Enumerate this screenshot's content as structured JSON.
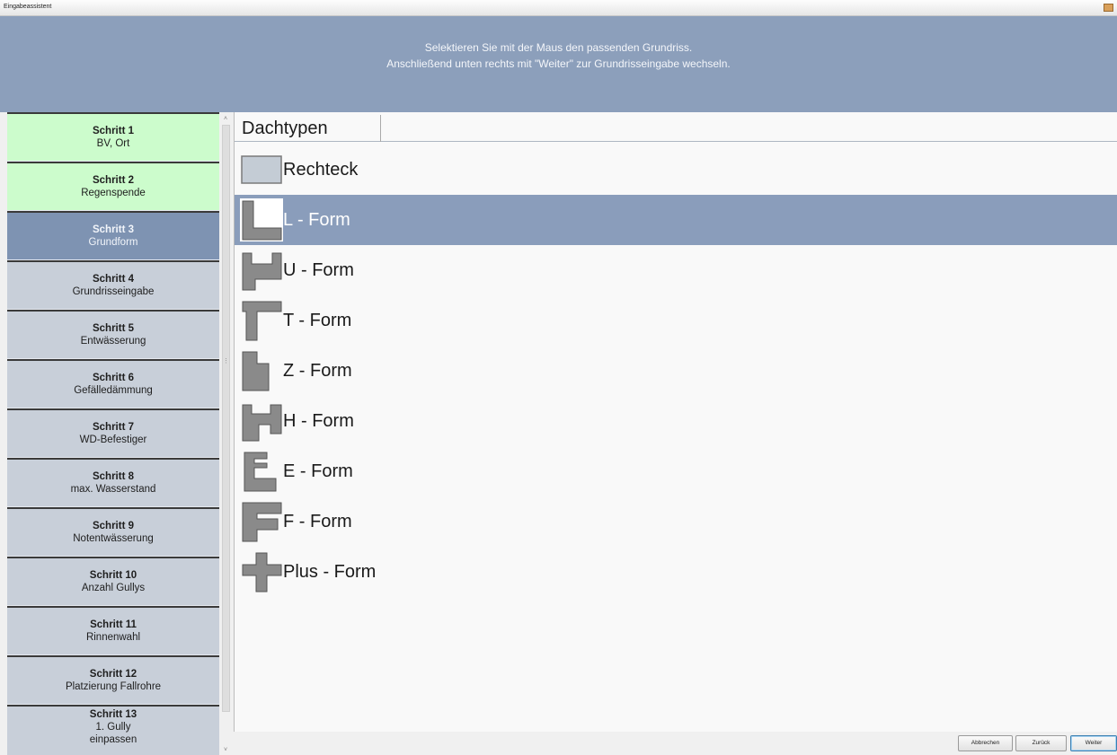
{
  "window": {
    "title": "Eingabeassistent"
  },
  "header": {
    "line1": "Selektieren Sie mit der Maus den passenden Grundriss.",
    "line2": "Anschließend unten rechts mit \"Weiter\" zur Grundrisseingabe wechseln."
  },
  "steps": [
    {
      "num": "Schritt 1",
      "name": "BV, Ort",
      "state": "done"
    },
    {
      "num": "Schritt 2",
      "name": "Regenspende",
      "state": "done"
    },
    {
      "num": "Schritt 3",
      "name": "Grundform",
      "state": "active"
    },
    {
      "num": "Schritt 4",
      "name": "Grundrisseingabe",
      "state": "pending"
    },
    {
      "num": "Schritt 5",
      "name": "Entwässerung",
      "state": "pending"
    },
    {
      "num": "Schritt 6",
      "name": "Gefälledämmung",
      "state": "pending"
    },
    {
      "num": "Schritt 7",
      "name": "WD-Befestiger",
      "state": "pending"
    },
    {
      "num": "Schritt 8",
      "name": "max. Wasserstand",
      "state": "pending"
    },
    {
      "num": "Schritt 9",
      "name": "Notentwässerung",
      "state": "pending"
    },
    {
      "num": "Schritt 10",
      "name": "Anzahl Gullys",
      "state": "pending"
    },
    {
      "num": "Schritt 11",
      "name": "Rinnenwahl",
      "state": "pending"
    },
    {
      "num": "Schritt 12",
      "name": "Platzierung Fallrohre",
      "state": "pending"
    },
    {
      "num": "Schritt 13",
      "name": "1. Gully",
      "name2": "einpassen",
      "state": "pending"
    }
  ],
  "tab": {
    "label": "Dachtypen"
  },
  "shapes": [
    {
      "label": "Rechteck",
      "icon": "rectangle-shape-icon",
      "selected": false
    },
    {
      "label": "L - Form",
      "icon": "l-shape-icon",
      "selected": true
    },
    {
      "label": "U - Form",
      "icon": "u-shape-icon",
      "selected": false
    },
    {
      "label": "T - Form",
      "icon": "t-shape-icon",
      "selected": false
    },
    {
      "label": "Z - Form",
      "icon": "z-shape-icon",
      "selected": false
    },
    {
      "label": "H - Form",
      "icon": "h-shape-icon",
      "selected": false
    },
    {
      "label": "E - Form",
      "icon": "e-shape-icon",
      "selected": false
    },
    {
      "label": "F - Form",
      "icon": "f-shape-icon",
      "selected": false
    },
    {
      "label": "Plus - Form",
      "icon": "plus-shape-icon",
      "selected": false
    }
  ],
  "buttons": {
    "cancel": "Abbrechen",
    "back": "Zurück",
    "next": "Weiter"
  },
  "colors": {
    "header_bg": "#8c9fbb",
    "step_done": "#ccfccc",
    "step_active": "#7e93b2",
    "step_pending": "#c8cfd9",
    "selection": "#8a9dbb",
    "shape_fill": "#8a8a8a"
  }
}
